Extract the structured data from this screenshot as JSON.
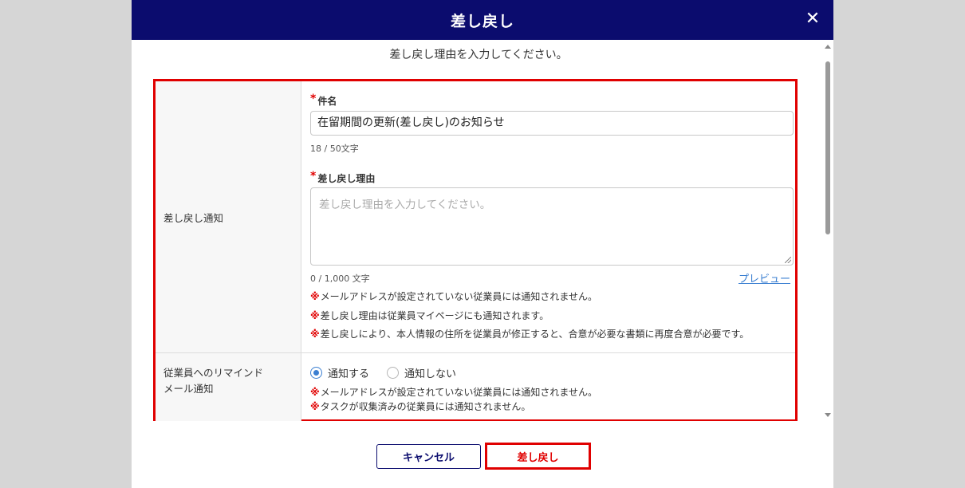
{
  "dialog": {
    "title": "差し戻し",
    "close_icon": "close-icon",
    "instruction": "差し戻し理由を入力してください。"
  },
  "notice_row": {
    "label": "差し戻し通知",
    "subject": {
      "label": "件名",
      "required_mark": "*",
      "value": "在留期間の更新(差し戻し)のお知らせ",
      "counter": "18 / 50文字"
    },
    "reason": {
      "label": "差し戻し理由",
      "required_mark": "*",
      "value": "",
      "placeholder": "差し戻し理由を入力してください。",
      "counter": "0 / 1,000 文字",
      "preview_link": "プレビュー"
    },
    "notes": [
      "メールアドレスが設定されていない従業員には通知されません。",
      "差し戻し理由は従業員マイページにも通知されます。",
      "差し戻しにより、本人情報の住所を従業員が修正すると、合意が必要な書類に再度合意が必要です。"
    ],
    "note_mark": "※"
  },
  "remind_row": {
    "label_line1": "従業員へのリマインド",
    "label_line2": "メール通知",
    "options": [
      {
        "label": "通知する",
        "selected": true
      },
      {
        "label": "通知しない",
        "selected": false
      }
    ],
    "notes": [
      "メールアドレスが設定されていない従業員には通知されません。",
      "タスクが収集済みの従業員には通知されません。"
    ]
  },
  "footer": {
    "cancel_label": "キャンセル",
    "submit_label": "差し戻し"
  },
  "colors": {
    "header_bg": "#0b0c6e",
    "highlight_red": "#e00000",
    "link_blue": "#3b7fd1"
  }
}
